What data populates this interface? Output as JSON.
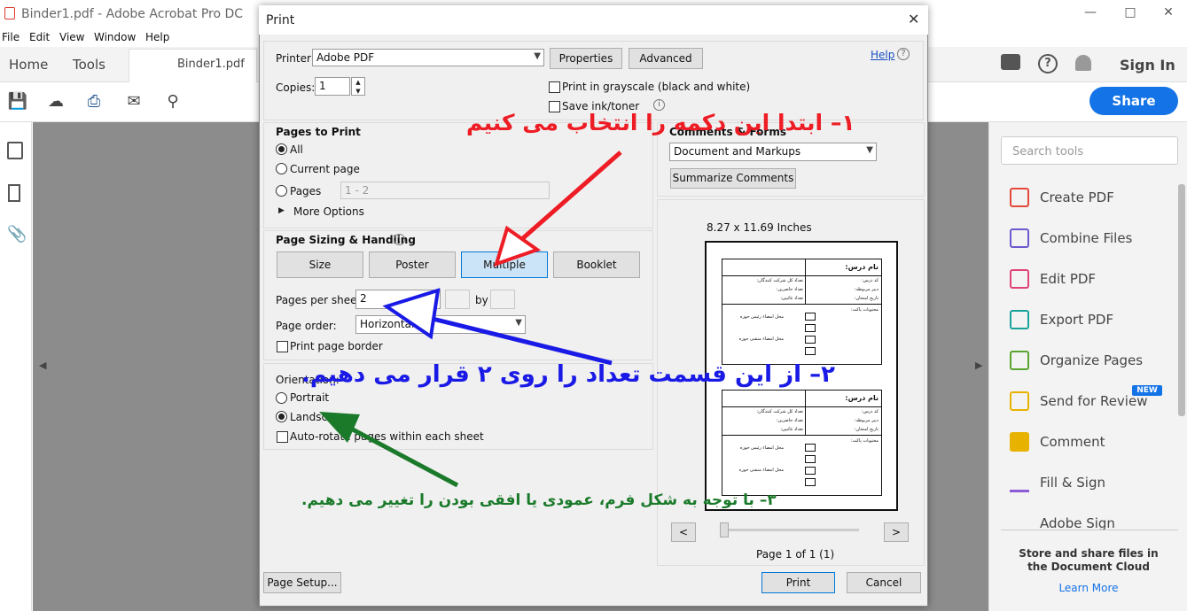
{
  "app": {
    "title": "Binder1.pdf - Adobe Acrobat Pro DC",
    "menu": [
      "File",
      "Edit",
      "View",
      "Window",
      "Help"
    ],
    "tabs": {
      "home": "Home",
      "tools": "Tools",
      "document": "Binder1.pdf"
    },
    "sign_in": "Sign In",
    "share": "Share"
  },
  "right_panel": {
    "search_placeholder": "Search tools",
    "tools": [
      {
        "label": "Create PDF",
        "icon": "create-pdf-icon",
        "color": "#e5493a"
      },
      {
        "label": "Combine Files",
        "icon": "combine-files-icon",
        "color": "#6a5acd"
      },
      {
        "label": "Edit PDF",
        "icon": "edit-pdf-icon",
        "color": "#e0427a"
      },
      {
        "label": "Export PDF",
        "icon": "export-pdf-icon",
        "color": "#1aa39a"
      },
      {
        "label": "Organize Pages",
        "icon": "organize-pages-icon",
        "color": "#5aa52e"
      },
      {
        "label": "Send for Review",
        "icon": "send-for-review-icon",
        "color": "#e8b300"
      },
      {
        "label": "Comment",
        "icon": "comment-icon",
        "color": "#e8b300"
      },
      {
        "label": "Fill & Sign",
        "icon": "fill-sign-icon",
        "color": "#8b5cd6"
      },
      {
        "label": "Adobe Sign",
        "icon": "adobe-sign-icon",
        "color": "#8b5cd6"
      }
    ],
    "new_badge": "NEW",
    "note": "Store and share files in the Document Cloud",
    "learn_more": "Learn More"
  },
  "dialog": {
    "title": "Print",
    "printer_label": "Printer:",
    "printer_value": "Adobe PDF",
    "properties": "Properties",
    "advanced": "Advanced",
    "help": "Help",
    "copies_label": "Copies:",
    "copies_value": "1",
    "grayscale": "Print in grayscale (black and white)",
    "save_ink": "Save ink/toner",
    "pages_to_print": {
      "title": "Pages to Print",
      "all": "All",
      "current": "Current page",
      "pages": "Pages",
      "pages_value": "1 - 2",
      "more_options": "More Options",
      "selected": "All"
    },
    "comments_forms": {
      "title": "Comments & Forms",
      "value": "Document and Markups",
      "summarize": "Summarize Comments"
    },
    "sizing": {
      "title": "Page Sizing & Handling",
      "buttons": [
        "Size",
        "Poster",
        "Multiple",
        "Booklet"
      ],
      "selected": "Multiple",
      "pps_label": "Pages per sheet:",
      "pps_value": "2",
      "by": "by",
      "order_label": "Page order:",
      "order_value": "Horizontal",
      "border": "Print page border"
    },
    "orientation": {
      "title": "Orientation:",
      "portrait": "Portrait",
      "landscape": "Landscape",
      "auto_rotate": "Auto-rotate pages within each sheet",
      "selected": "Landscape"
    },
    "preview": {
      "size": "8.27 x 11.69 Inches",
      "page_status": "Page 1 of 1 (1)",
      "prev": "<",
      "next": ">"
    },
    "page_setup": "Page Setup...",
    "print": "Print",
    "cancel": "Cancel"
  },
  "form_preview": {
    "title": "نام درس:",
    "code": "کد درس:",
    "teacher": "دبیر مربوطه:",
    "date": "تاریخ امتحان:",
    "participants": "تعداد کل شرکت کنندگان:",
    "present": "تعداد حاضرین:",
    "absent": "تعداد غائبین:",
    "signatures": "محل امضاء رئیس حوزه",
    "signatures2": "محل امضاء منشی حوزه",
    "contents": "محتویات پاکت:"
  },
  "annotations": {
    "step1": "۱– ابتدا این دکمه را انتخاب می کنیم",
    "step2": "۲– از این قسمت تعداد را روی ۲ قرار می دهیم.",
    "step3": "۳– با توجه به شکل فرم، عمودی یا افقی بودن را تغییر می دهیم.",
    "colors": {
      "step1": "#ee1c24",
      "step2": "#1a1ae6",
      "step3": "#1a7a2a"
    }
  }
}
